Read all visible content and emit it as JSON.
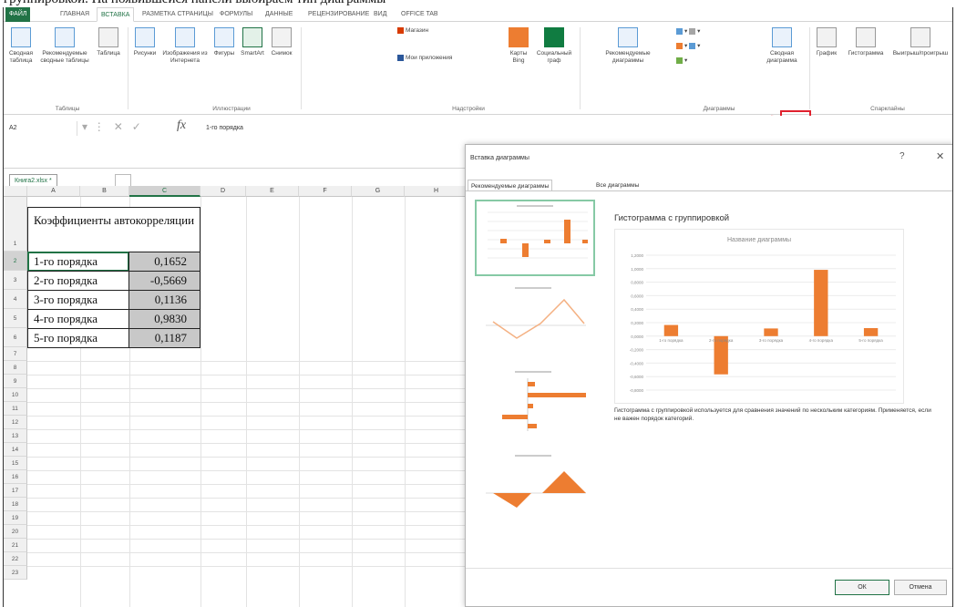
{
  "caption": "группировкой. На появившейся панели выбираем тип диаграммы",
  "ribbon_tabs": [
    "ФАЙЛ",
    "ГЛАВНАЯ",
    "ВСТАВКА",
    "РАЗМЕТКА СТРАНИЦЫ",
    "ФОРМУЛЫ",
    "ДАННЫЕ",
    "РЕЦЕНЗИРОВАНИЕ",
    "ВИД",
    "OFFICE TAB"
  ],
  "ribbon": {
    "pivot_table": "Сводная таблица",
    "recommended_pivots": "Рекомендуемые сводные таблицы",
    "table": "Таблица",
    "group_tables": "Таблицы",
    "pictures": "Рисунки",
    "online_pictures": "Изображения из Интернета",
    "shapes": "Фигуры",
    "smartart": "SmartArt",
    "screenshot": "Снимок",
    "group_illustrations": "Иллюстрации",
    "store": "Магазин",
    "my_apps": "Мои приложения",
    "bing_maps": "Карты Bing",
    "people_graph": "Социальный граф",
    "group_addins": "Надстройки",
    "recommended_charts": "Рекомендуемые диаграммы",
    "pivot_chart": "Сводная диаграмма",
    "group_charts": "Диаграммы",
    "sparkline_line": "График",
    "sparkline_column": "Гистограмма",
    "sparkline_winloss": "Выигрыш/проигрыш",
    "group_sparklines": "Спарклайны"
  },
  "formula_bar": {
    "name_box": "A2",
    "fx": "fx",
    "value": "1-го порядка"
  },
  "workbook_tab": "Книга2.xlsx *",
  "columns": [
    "A",
    "B",
    "C",
    "D",
    "E",
    "F",
    "G",
    "H"
  ],
  "rows": [
    "1",
    "2",
    "3",
    "4",
    "5",
    "6",
    "7",
    "8",
    "9",
    "10",
    "11",
    "12",
    "13",
    "14",
    "15",
    "16",
    "17",
    "18",
    "19",
    "20",
    "21",
    "22",
    "23"
  ],
  "table": {
    "header": "Коэффициенты автокорреляции",
    "rows": [
      {
        "label": "1-го порядка",
        "value": "0,1652"
      },
      {
        "label": "2-го порядка",
        "value": "-0,5669"
      },
      {
        "label": "3-го порядка",
        "value": "0,1136"
      },
      {
        "label": "4-го порядка",
        "value": "0,9830"
      },
      {
        "label": "5-го порядка",
        "value": "0,1187"
      }
    ]
  },
  "dialog": {
    "title": "Вставка диаграммы",
    "help": "?",
    "close": "✕",
    "tab_recommended": "Рекомендуемые диаграммы",
    "tab_all": "Все диаграммы",
    "chart_heading": "Гистограмма с группировкой",
    "description": "Гистограмма с группировкой используется для сравнения значений по нескольким категориям. Применяется, если не важен порядок категорий.",
    "ok": "ОК",
    "cancel": "Отмена"
  },
  "chart_data": {
    "type": "bar",
    "title": "Название диаграммы",
    "categories": [
      "1-го порядка",
      "2-го порядка",
      "3-го порядка",
      "4-го порядка",
      "5-го порядка"
    ],
    "values": [
      0.1652,
      -0.5669,
      0.1136,
      0.983,
      0.1187
    ],
    "ylim": [
      -0.8,
      1.2
    ],
    "yticks": [
      "1,2000",
      "1,0000",
      "0,8000",
      "0,6000",
      "0,4000",
      "0,2000",
      "0,0000",
      "-0,2000",
      "-0,4000",
      "-0,6000",
      "-0,8000"
    ],
    "color": "#ed7d31",
    "grid": true
  },
  "colors": {
    "excel_green": "#217346",
    "accent_orange": "#ed7d31",
    "annotation_red": "#e0212e"
  }
}
